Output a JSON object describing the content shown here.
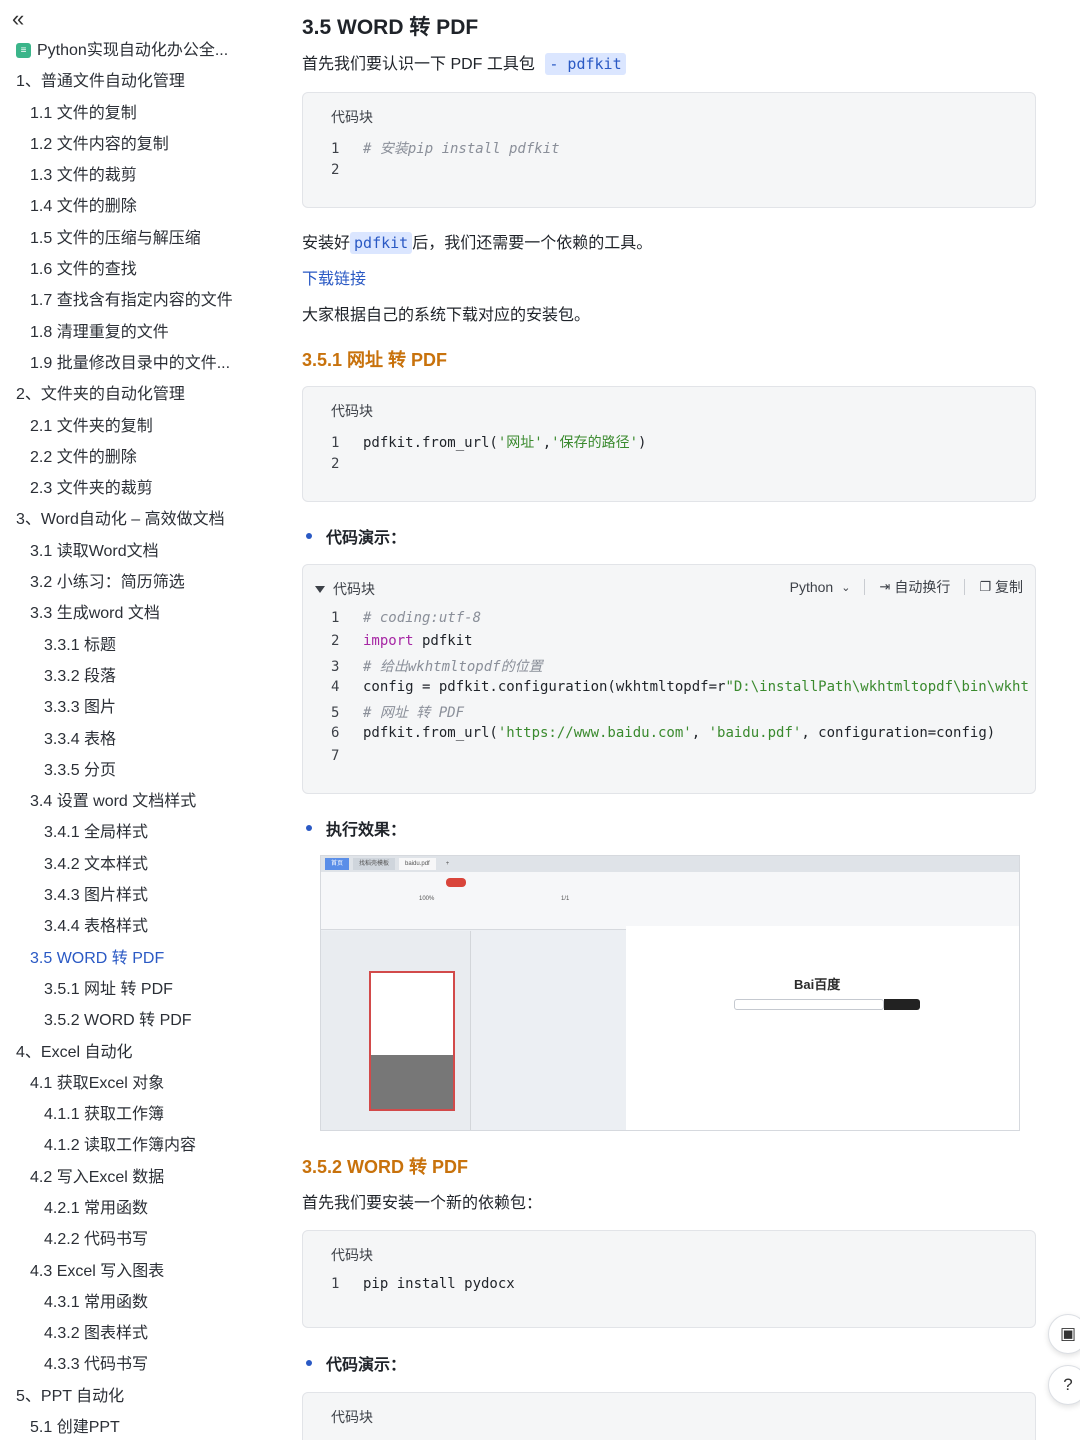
{
  "sidebar": {
    "collapse_icon": "«",
    "doc_title": "Python实现自动化办公全...",
    "items": [
      {
        "label": "1、普通文件自动化管理",
        "level": 0
      },
      {
        "label": "1.1 文件的复制",
        "level": 1
      },
      {
        "label": "1.2 文件内容的复制",
        "level": 1
      },
      {
        "label": "1.3 文件的裁剪",
        "level": 1
      },
      {
        "label": "1.4 文件的删除",
        "level": 1
      },
      {
        "label": "1.5 文件的压缩与解压缩",
        "level": 1
      },
      {
        "label": "1.6 文件的查找",
        "level": 1
      },
      {
        "label": "1.7 查找含有指定内容的文件",
        "level": 1
      },
      {
        "label": "1.8 清理重复的文件",
        "level": 1
      },
      {
        "label": "1.9 批量修改目录中的文件...",
        "level": 1
      },
      {
        "label": "2、文件夹的自动化管理",
        "level": 0
      },
      {
        "label": "2.1 文件夹的复制",
        "level": 1
      },
      {
        "label": "2.2 文件的删除",
        "level": 1
      },
      {
        "label": "2.3 文件夹的裁剪",
        "level": 1
      },
      {
        "label": "3、Word自动化 – 高效做文档",
        "level": 0
      },
      {
        "label": "3.1 读取Word文档",
        "level": 1
      },
      {
        "label": "3.2 小练习：简历筛选",
        "level": 1
      },
      {
        "label": "3.3 生成word 文档",
        "level": 1
      },
      {
        "label": "3.3.1 标题",
        "level": 2
      },
      {
        "label": "3.3.2 段落",
        "level": 2
      },
      {
        "label": "3.3.3 图片",
        "level": 2
      },
      {
        "label": "3.3.4 表格",
        "level": 2
      },
      {
        "label": "3.3.5 分页",
        "level": 2
      },
      {
        "label": "3.4 设置 word 文档样式",
        "level": 1
      },
      {
        "label": "3.4.1 全局样式",
        "level": 2
      },
      {
        "label": "3.4.2 文本样式",
        "level": 2
      },
      {
        "label": "3.4.3 图片样式",
        "level": 2
      },
      {
        "label": "3.4.4 表格样式",
        "level": 2
      },
      {
        "label": "3.5 WORD 转 PDF",
        "level": 1,
        "active": true
      },
      {
        "label": "3.5.1 网址 转 PDF",
        "level": 2
      },
      {
        "label": "3.5.2 WORD 转 PDF",
        "level": 2
      },
      {
        "label": "4、Excel 自动化",
        "level": 0
      },
      {
        "label": "4.1 获取Excel 对象",
        "level": 1
      },
      {
        "label": "4.1.1 获取工作簿",
        "level": 2
      },
      {
        "label": "4.1.2 读取工作簿内容",
        "level": 2
      },
      {
        "label": "4.2 写入Excel 数据",
        "level": 1
      },
      {
        "label": "4.2.1 常用函数",
        "level": 2
      },
      {
        "label": "4.2.2 代码书写",
        "level": 2
      },
      {
        "label": "4.3 Excel 写入图表",
        "level": 1
      },
      {
        "label": "4.3.1 常用函数",
        "level": 2
      },
      {
        "label": "4.3.2 图表样式",
        "level": 2
      },
      {
        "label": "4.3.3 代码书写",
        "level": 2
      },
      {
        "label": "5、PPT 自动化",
        "level": 0
      },
      {
        "label": "5.1 创建PPT",
        "level": 1
      }
    ]
  },
  "content": {
    "title": "3.5 WORD 转 PDF",
    "intro_text": "首先我们要认识一下 PDF 工具包",
    "intro_code": "- pdfkit",
    "code_label": "代码块",
    "block1": {
      "lines": [
        {
          "n": "1",
          "code": "# 安装pip install pdfkit"
        },
        {
          "n": "2",
          "code": ""
        }
      ]
    },
    "install_pre": "安装好",
    "install_code": "pdfkit",
    "install_post": "后，我们还需要一个依赖的工具。",
    "download_link": "下载链接",
    "download_text": "大家根据自己的系统下载对应的安装包。",
    "sec1_title": "3.5.1 网址 转 PDF",
    "block2": {
      "line1_n": "1",
      "line1_a": "pdfkit.from_url(",
      "line1_s1": "'网址'",
      "line1_c": ",",
      "line1_s2": "'保存的路径'",
      "line1_e": ")",
      "line2_n": "2"
    },
    "bullet_demo": "代码演示：",
    "block3": {
      "toolbar_lang": "Python",
      "toolbar_wrap": "自动换行",
      "toolbar_copy": "复制",
      "l1_n": "1",
      "l1": "# coding:utf-8",
      "l2_n": "2",
      "l2_kw": "import",
      "l2_rest": " pdfkit",
      "l3_n": "3",
      "l3": "# 给出wkhtmltopdf的位置",
      "l4_n": "4",
      "l4_a": "config = pdfkit.configuration(wkhtmltopdf=r",
      "l4_s": "\"D:\\installPath\\wkhtmltopdf\\bin\\wkht",
      "l5_n": "5",
      "l5": "# 网址 转 PDF",
      "l6_n": "6",
      "l6_a": "pdfkit.from_url(",
      "l6_s1": "'https://www.baidu.com'",
      "l6_c": ", ",
      "l6_s2": "'baidu.pdf'",
      "l6_e": ", configuration=config)",
      "l7_n": "7"
    },
    "bullet_result": "执行效果：",
    "screenshot": {
      "tab1": "首页",
      "tab2": "找稻壳模板",
      "tab3": "baidu.pdf",
      "tab_add": "+",
      "page_indicator": "1/1",
      "zoom": "100%",
      "baidu_logo": "Bai百度"
    },
    "sec2_title": "3.5.2 WORD 转 PDF",
    "sec2_text": "首先我们要安装一个新的依赖包：",
    "block4": {
      "l1_n": "1",
      "l1": "pip install pydocx"
    },
    "bullet_demo2": "代码演示："
  },
  "floating": {
    "doc_icon": "▣",
    "help_icon": "?"
  }
}
